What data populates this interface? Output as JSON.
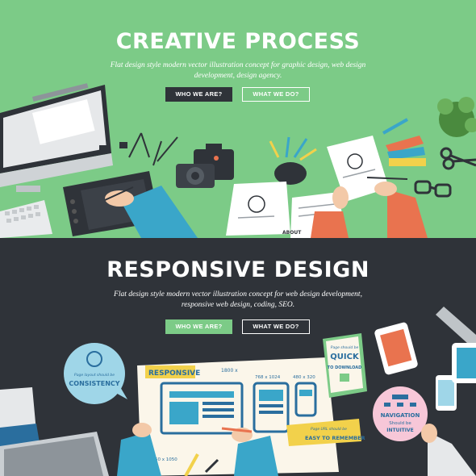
{
  "top_banner": {
    "title": "CREATIVE PROCESS",
    "subtitle": "Flat design style modern vector illustration concept for graphic design, web design development, design agency.",
    "who_button": "WHO WE ARE?",
    "what_button": "WHAT WE DO?",
    "about_label": "ABOUT"
  },
  "bottom_banner": {
    "title": "RESPONSIVE DESIGN",
    "subtitle": "Flat design style modern vector illustration concept for web design development, responsive web design, coding, SEO.",
    "who_button": "WHO WE ARE?",
    "what_button": "WHAT WE DO?",
    "labels": {
      "responsive": "RESPONSIVE",
      "size_1800": "1800 x",
      "size_768": "768 x 1024",
      "size_480": "480 x 320",
      "size_1850": "1850 x 1050",
      "consistency": "CONSISTENCY",
      "consistency_small": "Page layout should be",
      "quick": "QUICK",
      "quick_small": "Page should be",
      "download": "TO DOWNLOAD",
      "navigation": "NAVIGATION",
      "nav_should": "Should be",
      "intuitive": "INTUITIVE",
      "easy": "EASY TO REMEMBER",
      "easy_small": "Page URL should be"
    }
  },
  "colors": {
    "green": "#7ccb87",
    "dark": "#2f3339",
    "accent_orange": "#e9734f",
    "accent_blue": "#3aa6c9",
    "yellow": "#f2d14b"
  }
}
